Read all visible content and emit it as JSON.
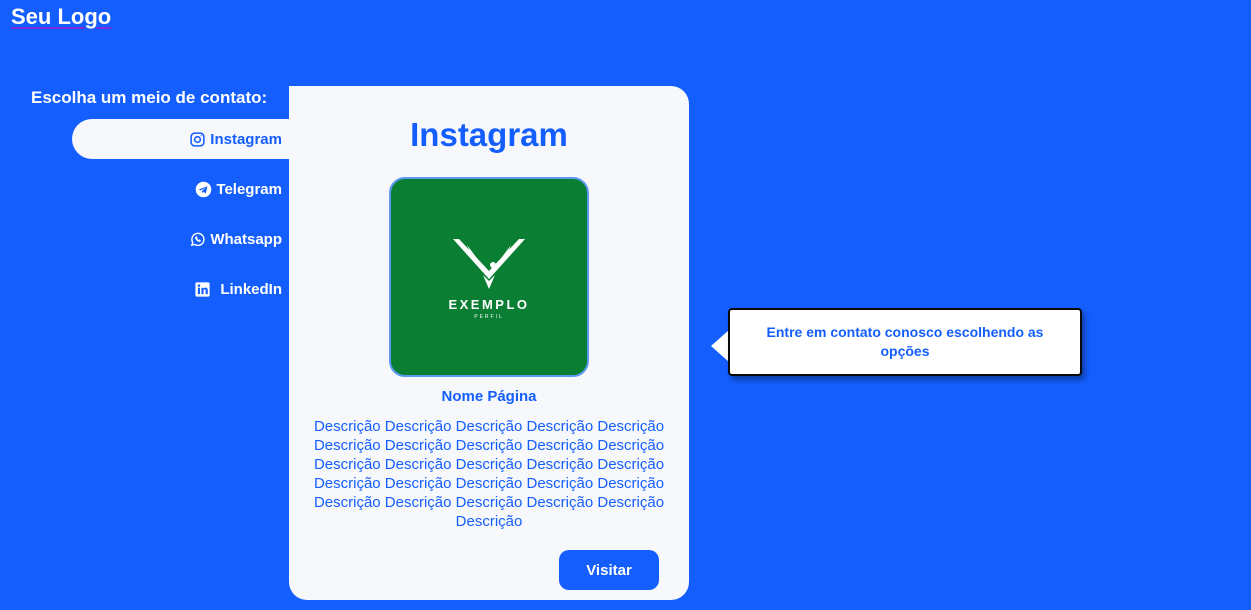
{
  "header": {
    "logo": "Seu Logo"
  },
  "sidebar": {
    "heading": "Escolha um meio de contato:",
    "items": [
      {
        "label": "Instagram",
        "icon": "instagram-icon",
        "active": true
      },
      {
        "label": "Telegram",
        "icon": "telegram-icon",
        "active": false
      },
      {
        "label": "Whatsapp",
        "icon": "whatsapp-icon",
        "active": false
      },
      {
        "label": "LinkedIn",
        "icon": "linkedin-icon",
        "active": false
      }
    ]
  },
  "card": {
    "title": "Instagram",
    "profile": {
      "brand": "EXEMPLO",
      "brand_sub": "PERFIL"
    },
    "page_name": "Nome Página",
    "description": "Descrição Descrição Descrição Descrição Descrição Descrição Descrição Descrição Descrição Descrição Descrição Descrição Descrição Descrição Descrição Descrição Descrição Descrição Descrição Descrição Descrição Descrição Descrição Descrição Descrição Descrição",
    "visit_label": "Visitar"
  },
  "tooltip": {
    "text": "Entre em contato conosco escolhendo as opções"
  },
  "colors": {
    "primary": "#155efe",
    "card_bg": "#f6f8fb",
    "profile_bg": "#0a7f33"
  }
}
